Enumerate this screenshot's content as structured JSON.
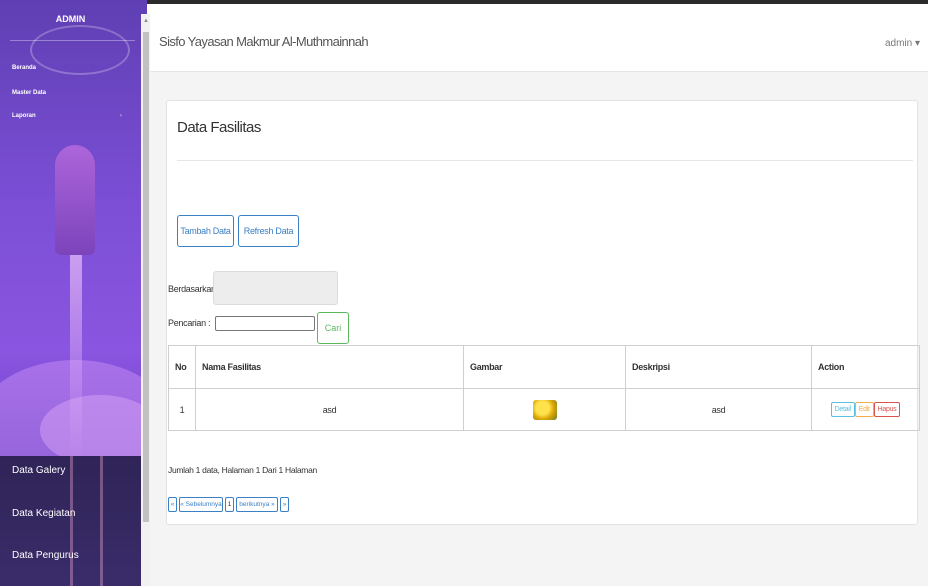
{
  "sidebar": {
    "brand": "ADMIN",
    "menu_top": [
      "Beranda",
      "Master Data",
      "Laporan"
    ],
    "menu_bottom": [
      "Data Galery",
      "Data Kegiatan",
      "Data Pengurus"
    ]
  },
  "topbar": {
    "title": "Sisfo Yayasan Makmur Al-Muthmainnah",
    "user": "admin ▾"
  },
  "panel": {
    "heading": "Data Fasilitas",
    "buttons": {
      "tambah": "Tambah Data",
      "refresh": "Refresh Data"
    },
    "filter_label": "Berdasarkan:",
    "search_label": "Pencarian :",
    "search_value": "",
    "search_button": "Cari",
    "table": {
      "headers": [
        "No",
        "Nama Fasilitas",
        "Gambar",
        "Deskripsi",
        "Action"
      ],
      "rows": [
        {
          "no": "1",
          "nama": "asd",
          "gambar": "flower-image",
          "deskripsi": "asd"
        }
      ],
      "actions": {
        "detail": "Detail",
        "edit": "Edit",
        "hapus": "Hapus"
      }
    },
    "info": "Jumlah 1 data, Halaman 1 Dari 1 Halaman",
    "pagination": {
      "first": "«",
      "prev": "« Sebelumnya",
      "page": "1",
      "next": "berikutnya »",
      "last": "»"
    }
  }
}
